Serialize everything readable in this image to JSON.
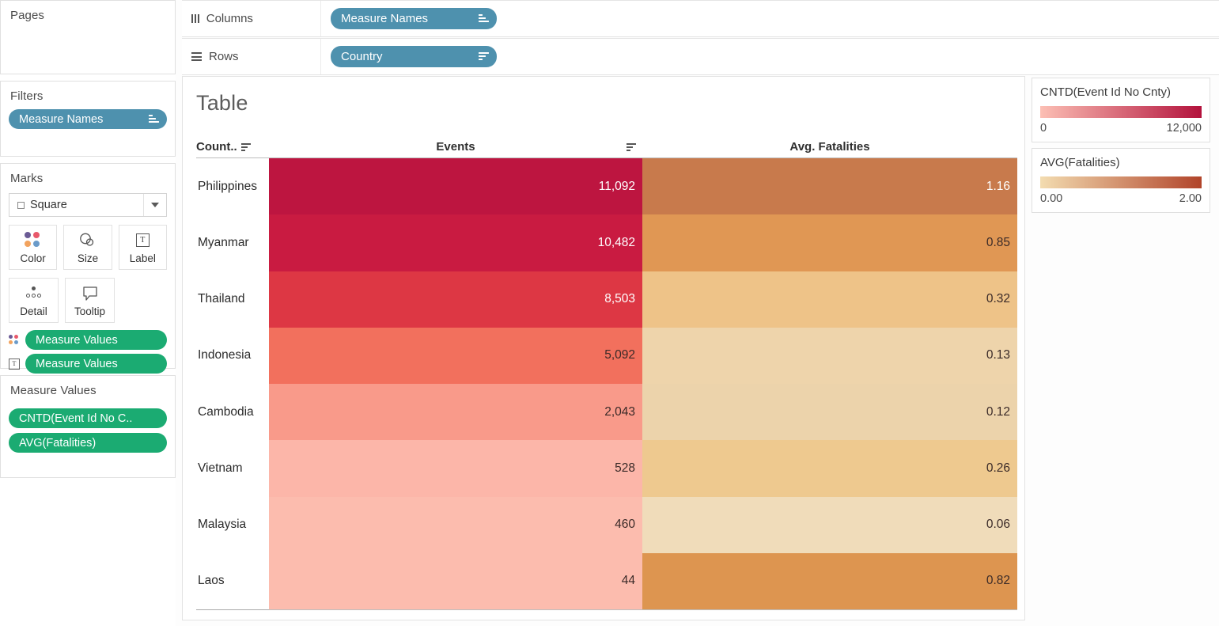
{
  "sidebar": {
    "pages": {
      "title": "Pages"
    },
    "filters": {
      "title": "Filters",
      "pill": {
        "label": "Measure Names",
        "icon": "sort-ascending-icon"
      }
    },
    "marks": {
      "title": "Marks",
      "mark_type": "Square",
      "mark_type_icon": "square-icon",
      "dropdown_icon": "chevron-down-icon",
      "buttons": [
        {
          "label": "Color",
          "icon": "color-dots-icon"
        },
        {
          "label": "Size",
          "icon": "size-circles-icon"
        },
        {
          "label": "Label",
          "icon": "label-text-icon"
        },
        {
          "label": "Detail",
          "icon": "detail-dots-icon"
        },
        {
          "label": "Tooltip",
          "icon": "tooltip-bubble-icon"
        }
      ],
      "encodings": [
        {
          "icon": "color-dots-icon",
          "label": "Measure Values"
        },
        {
          "icon": "label-text-icon",
          "label": "Measure Values"
        }
      ]
    },
    "measure_values": {
      "title": "Measure Values",
      "pills": [
        {
          "label": "CNTD(Event Id No C.."
        },
        {
          "label": "AVG(Fatalities)"
        }
      ]
    }
  },
  "shelves": {
    "columns": {
      "label": "Columns",
      "icon": "columns-icon",
      "pill": {
        "label": "Measure Names",
        "icon": "sort-ascending-icon"
      }
    },
    "rows": {
      "label": "Rows",
      "icon": "rows-icon",
      "pill": {
        "label": "Country",
        "icon": "sort-descending-icon"
      }
    }
  },
  "viz": {
    "title": "Table",
    "headers": {
      "country": "Count..",
      "country_sort_icon": "sort-icon",
      "events": "Events",
      "events_sort_icon": "sort-icon",
      "fatalities": "Avg. Fatalities"
    }
  },
  "legends": [
    {
      "title": "CNTD(Event Id No Cnty)",
      "min": "0",
      "max": "12,000",
      "gradient_from": "#fcbfb4",
      "gradient_to": "#b3123c"
    },
    {
      "title": "AVG(Fatalities)",
      "min": "0.00",
      "max": "2.00",
      "gradient_from": "#f3dcb0",
      "gradient_to": "#b1442a"
    }
  ],
  "chart_data": {
    "type": "heatmap",
    "title": "Table",
    "row_field": "Country",
    "column_field": "Measure Names",
    "categories": [
      "Philippines",
      "Myanmar",
      "Thailand",
      "Indonesia",
      "Cambodia",
      "Vietnam",
      "Malaysia",
      "Laos"
    ],
    "series": [
      {
        "name": "Events",
        "measure": "CNTD(Event Id No Cnty)",
        "values": [
          11092,
          10482,
          8503,
          5092,
          2043,
          528,
          460,
          44
        ],
        "labels": [
          "11,092",
          "10,482",
          "8,503",
          "5,092",
          "2,043",
          "528",
          "460",
          "44"
        ],
        "colors": [
          "#bd1540",
          "#c91b41",
          "#dd3744",
          "#f2705d",
          "#f99a8a",
          "#fcb6a9",
          "#fcbcae",
          "#fcbcae"
        ],
        "text_colors": [
          "#ffffff",
          "#ffffff",
          "#ffffff",
          "#3a2a28",
          "#3a2a28",
          "#3a2a28",
          "#3a2a28",
          "#3a2a28"
        ],
        "color_scale": {
          "min": 0,
          "max": 12000
        }
      },
      {
        "name": "Avg. Fatalities",
        "measure": "AVG(Fatalities)",
        "values": [
          1.16,
          0.85,
          0.32,
          0.13,
          0.12,
          0.26,
          0.06,
          0.82
        ],
        "labels": [
          "1.16",
          "0.85",
          "0.32",
          "0.13",
          "0.12",
          "0.26",
          "0.06",
          "0.82"
        ],
        "colors": [
          "#c87a4c",
          "#e09754",
          "#eec388",
          "#eed4ab",
          "#ecd3ab",
          "#eec98f",
          "#f0dcba",
          "#dd9550"
        ],
        "text_colors": [
          "#ffffff",
          "#3a2a28",
          "#3a2a28",
          "#3a2a28",
          "#3a2a28",
          "#3a2a28",
          "#3a2a28",
          "#3a2a28"
        ],
        "color_scale": {
          "min": 0,
          "max": 2
        }
      }
    ],
    "legend_position": "right",
    "grid": false
  }
}
